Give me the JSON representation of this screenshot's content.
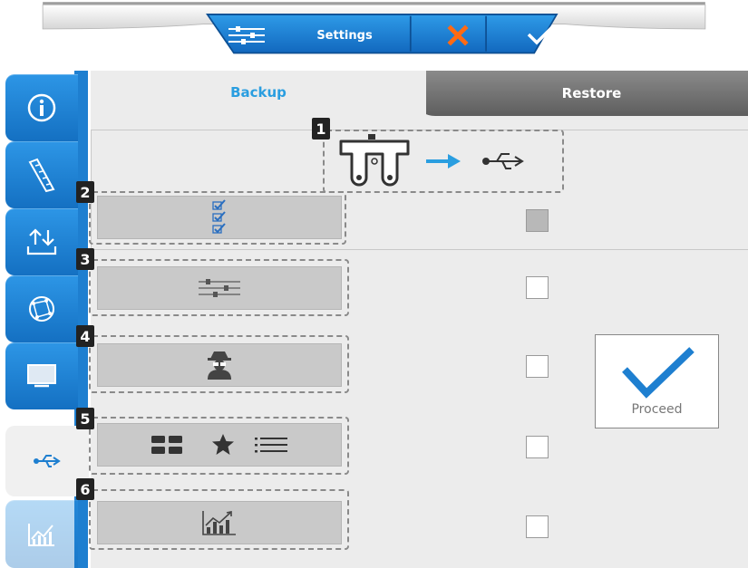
{
  "toolbar": {
    "settings_label": "Settings",
    "icons": [
      "sliders-icon",
      "close-icon",
      "check-icon"
    ],
    "colors": {
      "blue": "#1e7fd0",
      "cancel": "#ff6a13"
    }
  },
  "sidebar": {
    "items": [
      {
        "name": "info-icon",
        "active": false
      },
      {
        "name": "ruler-icon",
        "active": false
      },
      {
        "name": "upload-download-icon",
        "active": false
      },
      {
        "name": "network-icon",
        "active": false
      },
      {
        "name": "monitor-icon",
        "active": false
      },
      {
        "name": "usb-icon",
        "active": true
      },
      {
        "name": "chart-icon",
        "active": false,
        "disabled": true
      }
    ]
  },
  "tabs": [
    {
      "label": "Backup",
      "active": true
    },
    {
      "label": "Restore",
      "active": false
    }
  ],
  "callouts": [
    "1",
    "2",
    "3",
    "4",
    "5",
    "6"
  ],
  "rows": [
    {
      "icon": "checklist-icon",
      "checked": true
    },
    {
      "icon": "sliders-icon",
      "checked": false
    },
    {
      "icon": "user-spy-icon",
      "checked": false
    },
    {
      "icon": "layout-star-list-icon",
      "checked": false
    },
    {
      "icon": "chart-icon",
      "checked": false
    }
  ],
  "proceed": {
    "label": "Proceed",
    "icon": "check-icon"
  },
  "accent": "#2a9ee0"
}
